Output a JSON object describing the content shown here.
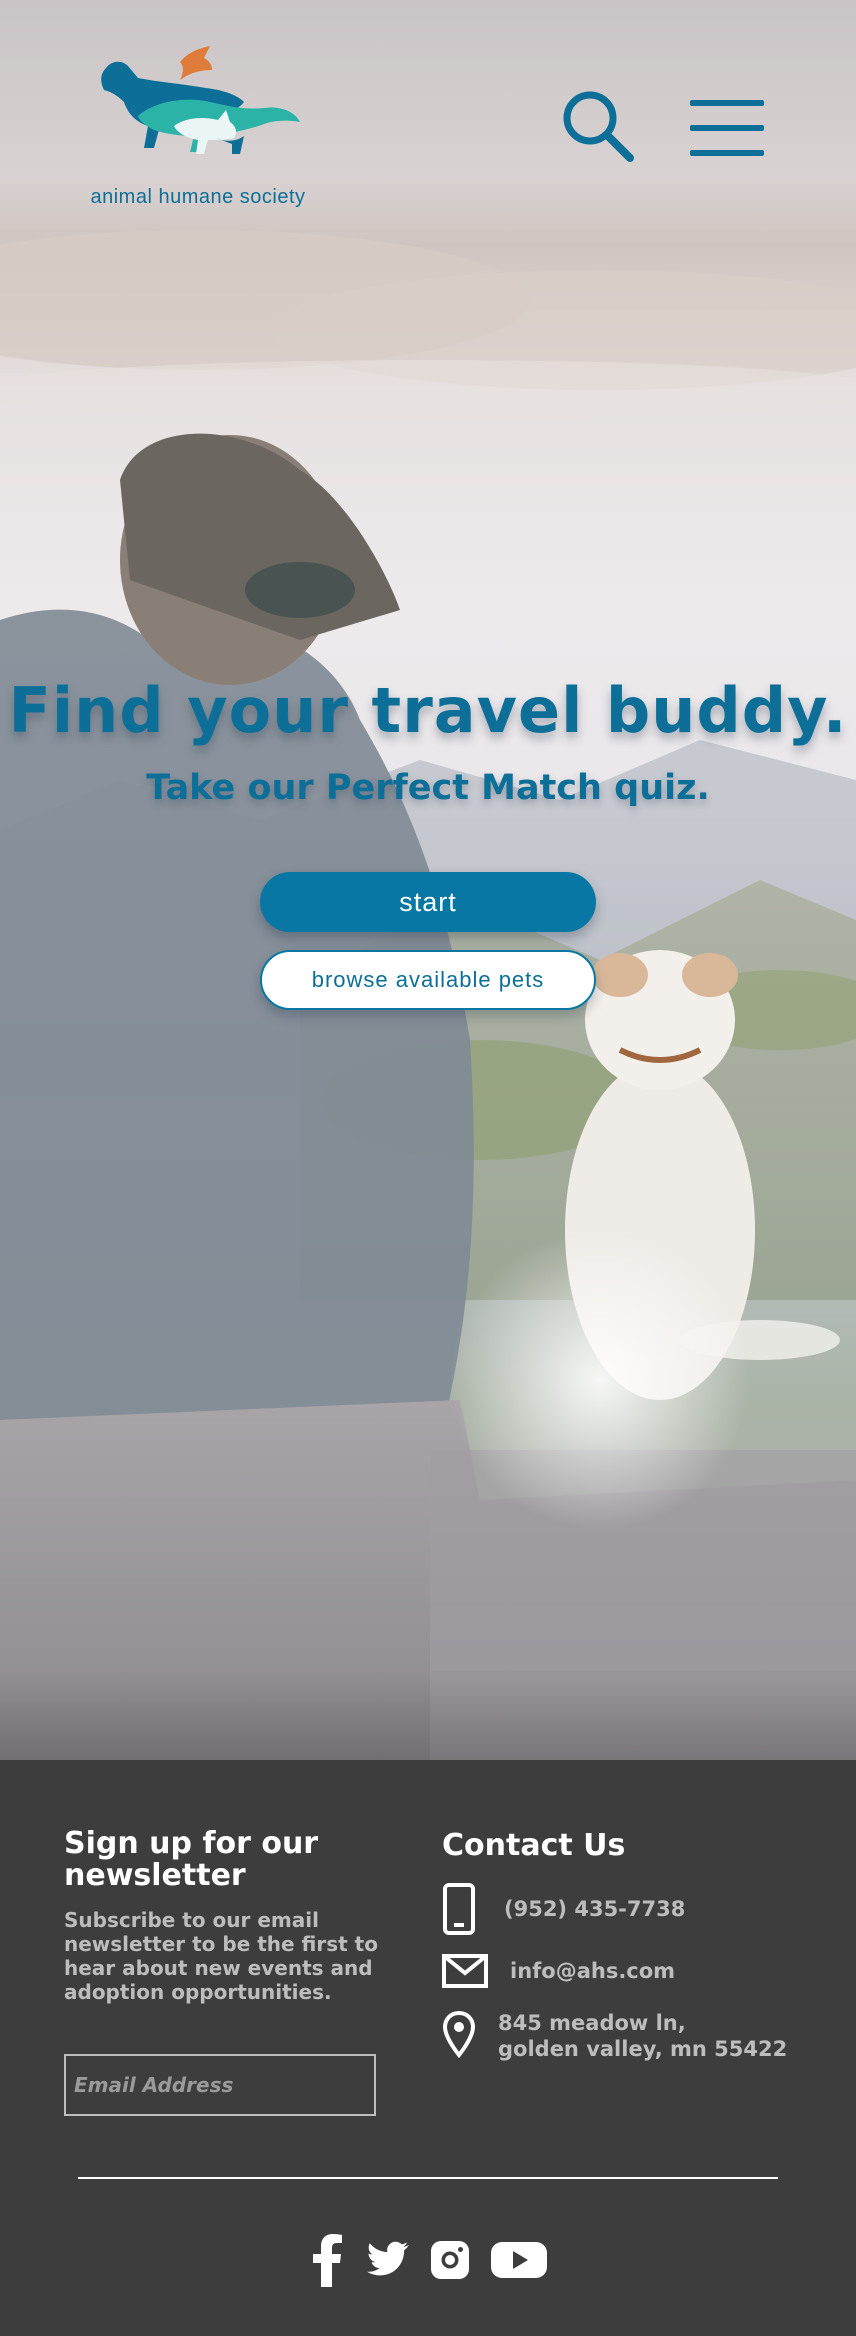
{
  "header": {
    "logo_text": "animal humane society",
    "search_icon": "search-icon",
    "menu_icon": "hamburger-menu-icon"
  },
  "hero": {
    "headline": "Find your travel buddy.",
    "subline": "Take our Perfect Match quiz.",
    "start_label": "start",
    "browse_label": "browse available pets"
  },
  "newsletter": {
    "heading": "Sign up for our newsletter",
    "description": "Subscribe to our email newsletter to be the first to hear about new events and adoption opportunities.",
    "email_placeholder": "Email Address",
    "email_value": ""
  },
  "contact": {
    "heading": "Contact Us",
    "phone": "(952) 435-7738",
    "email": "info@ahs.com",
    "address_line1": "845 meadow ln,",
    "address_line2": "golden valley, mn 55422",
    "icons": [
      "phone-icon",
      "mail-icon",
      "location-pin-icon"
    ]
  },
  "social": {
    "icons": [
      "facebook-icon",
      "twitter-icon",
      "instagram-icon",
      "youtube-icon"
    ]
  },
  "colors": {
    "brand_blue": "#0d6f97",
    "button_blue": "#0877a3",
    "footer_bg": "#3d3d3d",
    "logo_orange": "#e07c3a",
    "logo_teal": "#2bb3a8"
  }
}
